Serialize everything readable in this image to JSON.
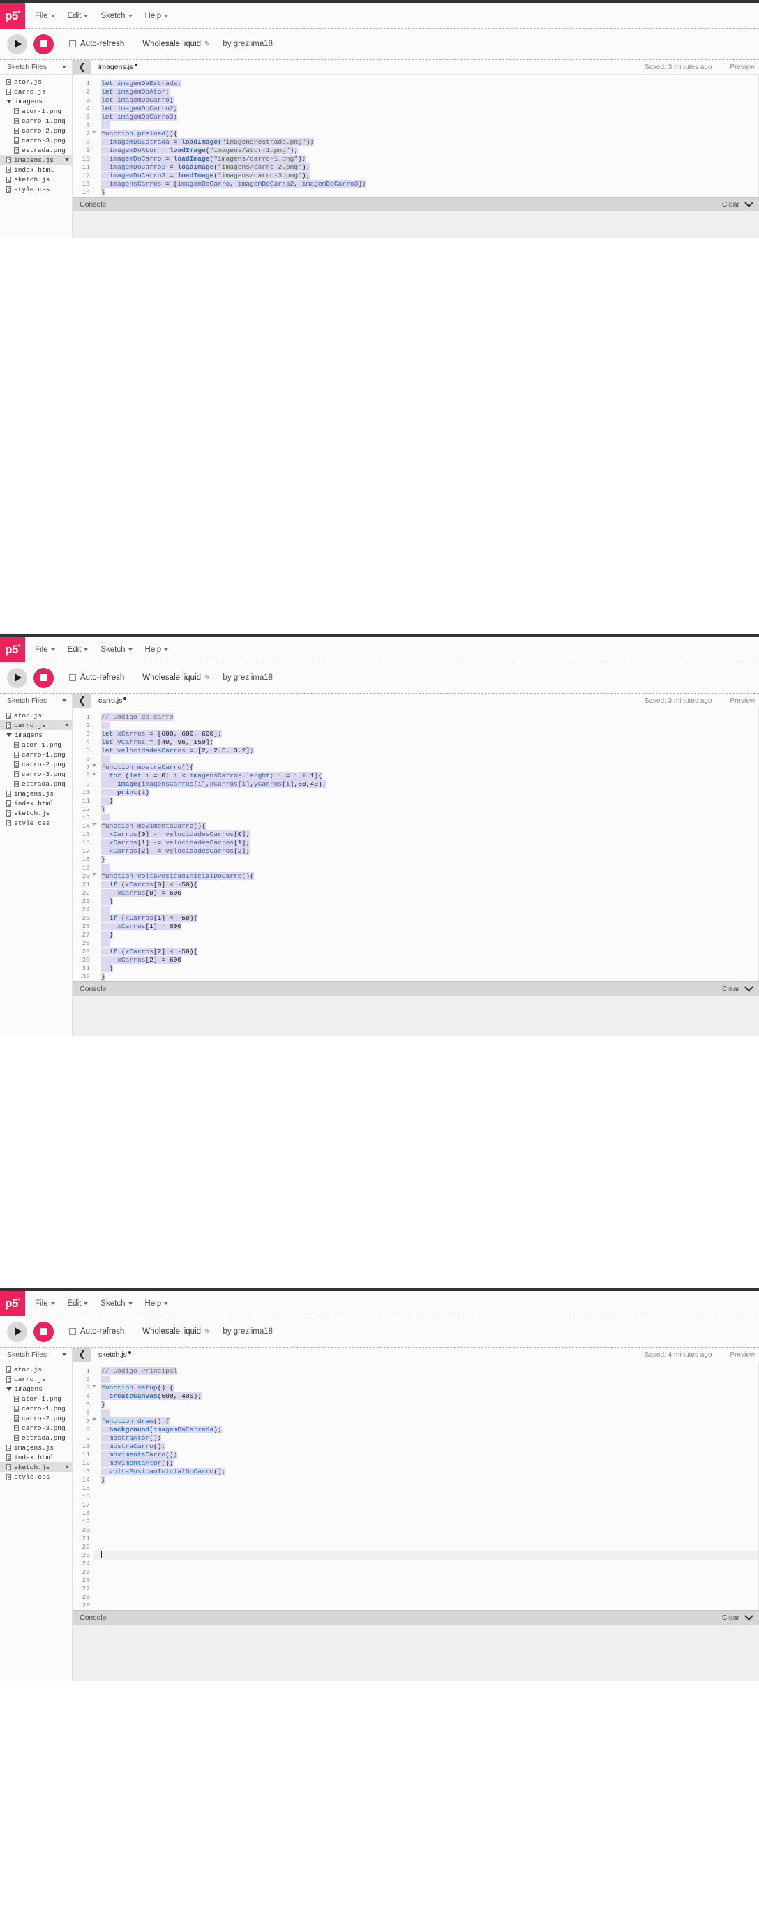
{
  "app": {
    "logo": "p5",
    "logo_sup": "*",
    "brand_color": "#ed225d",
    "menu": [
      {
        "label": "File"
      },
      {
        "label": "Edit"
      },
      {
        "label": "Sketch"
      },
      {
        "label": "Help"
      }
    ],
    "toolbar": {
      "play_icon": "play-icon",
      "stop_icon": "stop-icon",
      "autorefresh_label": "Auto-refresh",
      "autorefresh_checked": false,
      "sketch_name": "Wholesale liquid",
      "edit_icon": "pencil-icon",
      "author": "by grezlima18"
    },
    "sidebar": {
      "title": "Sketch Files",
      "files": [
        {
          "name": "ator.js",
          "type": "file",
          "indent": 0,
          "selected": false
        },
        {
          "name": "carro.js",
          "type": "file",
          "indent": 0,
          "selected": false
        },
        {
          "name": "imagens",
          "type": "folder-open",
          "indent": 0,
          "selected": false
        },
        {
          "name": "ator-1.png",
          "type": "file",
          "indent": 1,
          "selected": false
        },
        {
          "name": "carro-1.png",
          "type": "file",
          "indent": 1,
          "selected": false
        },
        {
          "name": "carro-2.png",
          "type": "file",
          "indent": 1,
          "selected": false
        },
        {
          "name": "carro-3.png",
          "type": "file",
          "indent": 1,
          "selected": false
        },
        {
          "name": "estrada.png",
          "type": "file",
          "indent": 1,
          "selected": false
        },
        {
          "name": "imagens.js",
          "type": "file",
          "indent": 0,
          "selected": false
        },
        {
          "name": "index.html",
          "type": "file",
          "indent": 0,
          "selected": false
        },
        {
          "name": "sketch.js",
          "type": "file",
          "indent": 0,
          "selected": false
        },
        {
          "name": "style.css",
          "type": "file",
          "indent": 0,
          "selected": false
        }
      ]
    },
    "console": {
      "label": "Console",
      "clear_label": "Clear",
      "chevron_icon": "chevron-down-icon"
    },
    "preview_label": "Preview",
    "collapse_icon": "chevron-left-icon"
  },
  "panels": [
    {
      "id": "panel-imagens",
      "tab_name": "imagens.js",
      "unsaved": true,
      "saved_text": "Saved: 3 minutes ago",
      "selected_file": "imagens.js",
      "line_count": 14,
      "fold_lines": [
        7
      ],
      "active_line": null,
      "code": [
        "let imagemDaEstrada;",
        "let imagemDoAtor;",
        "let imagemDoCarro;",
        "let imagemDoCarro2;",
        "let imagemDoCarro3;",
        "",
        "function preload(){",
        "  imagemDaEstrada = loadImage(\"imagens/estrada.png\");",
        "  imagemDoAtor = loadImage(\"imagens/ator-1.png\");",
        "  imagemDoCarro = loadImage(\"imagens/carro-1.png\");",
        "  imagemDoCarro2 = loadImage(\"imagens/carro-2.png\");",
        "  imagemDoCarro3 = loadImage(\"imagens/carro-3.png\");",
        "  imagensCarros = [imagemDoCarro, imagemDoCarro2, imagemDoCarro3];",
        "}"
      ]
    },
    {
      "id": "panel-carro",
      "tab_name": "carro.js",
      "unsaved": true,
      "saved_text": "Saved: 3 minutes ago",
      "selected_file": "carro.js",
      "line_count": 32,
      "fold_lines": [
        7,
        8,
        14,
        20
      ],
      "active_line": null,
      "code": [
        "// Código do carro",
        "",
        "let xCarros = [600, 600, 600];",
        "let yCarros = [40, 96, 150];",
        "let velocidadesCarros = [2, 2.5, 3.2];",
        "",
        "function mostraCarro(){",
        "  for (let i = 0; i < imagensCarros.lenght; i = i + 1){",
        "    image(imagensCarros[i],xCarros[i],yCarros[i],50,40);",
        "    print(i)",
        "  }",
        "}",
        "",
        "function movimentaCarro(){",
        "  xCarros[0] -= velocidadesCarros[0];",
        "  xCarros[1] -= velocidadesCarros[1];",
        "  xCarros[2] -= velocidadesCarros[2];",
        "}",
        "",
        "function voltaPosicaoInicialDoCarro(){",
        "  if (xCarros[0] < -50){",
        "    xCarros[0] = 600",
        "  }",
        "",
        "  if (xCarros[1] < -50){",
        "    xCarros[1] = 600",
        "  }",
        "",
        "  if (xCarros[2] < -50){",
        "    xCarros[2] = 600",
        "  }",
        "}"
      ]
    },
    {
      "id": "panel-sketch",
      "tab_name": "sketch.js",
      "unsaved": true,
      "saved_text": "Saved: 4 minutes ago",
      "selected_file": "sketch.js",
      "line_count": 29,
      "fold_lines": [
        3,
        7
      ],
      "active_line": 23,
      "code": [
        "// Código Principal",
        "",
        "function setup() {",
        "  createCanvas(500, 400);",
        "}",
        "",
        "function draw() {",
        "  background(imagemDaEstrada);",
        "  mostraAtor();",
        "  mostraCarro();",
        "  movimentaCarro();",
        "  movimentaAtor();",
        "  voltaPosicaoInicialDoCarro();",
        "}"
      ]
    }
  ]
}
